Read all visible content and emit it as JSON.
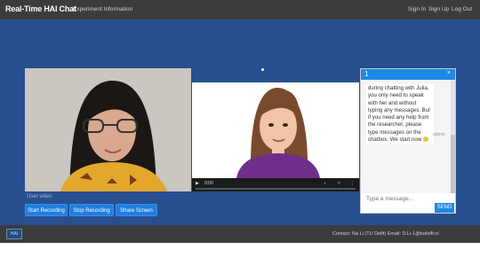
{
  "navbar": {
    "brand": "Real-Time HAI Chat",
    "experiment_link": "Experiment Information",
    "sign_in": "Sign In",
    "sign_up": "Sign Up",
    "log_out": "Log Out"
  },
  "video": {
    "label": "User video",
    "player_time": "0:00",
    "progress": 0.0
  },
  "controls": {
    "start_recording": "Start Recording",
    "stop_recording": "Stop Recording",
    "share_screen": "Share Screen"
  },
  "chat": {
    "title": "1",
    "close": "×",
    "message": "during chatting with Julia, you only need to speak with her and without typing any messages. But if you need any help from the researcher, please type messages on the chatbox. We start now",
    "author": "admin",
    "input_placeholder": "Type a message...",
    "send_label": "SEND"
  },
  "footer": {
    "logo_text": "HAI",
    "contact": "Contact: Na Li (TU Delft) Email: D.Li-1@tudelft.nl"
  },
  "colors": {
    "main_bg": "#284f8f",
    "nav_bg": "#3c3c3c",
    "accent": "#1e88e5"
  }
}
